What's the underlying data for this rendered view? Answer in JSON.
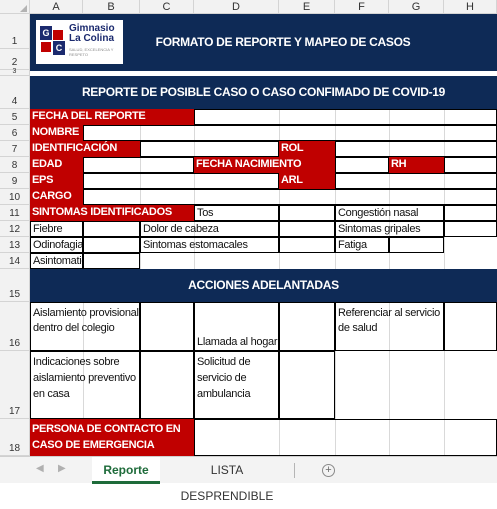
{
  "columns": [
    "A",
    "B",
    "C",
    "D",
    "E",
    "F",
    "G",
    "H"
  ],
  "rows": [
    "1",
    "2",
    "3",
    "4",
    "5",
    "6",
    "7",
    "8",
    "9",
    "10",
    "11",
    "12",
    "13",
    "14",
    "15",
    "16",
    "17",
    "18"
  ],
  "logo": {
    "initials_top": "G",
    "initials_bottom": "C",
    "name_line1": "Gimnasio",
    "name_line2": "La Colina",
    "tagline": "SALUD, EXCELENCIA Y RESPETO"
  },
  "title": "FORMATO DE REPORTE Y MAPEO DE CASOS",
  "subtitle": "REPORTE DE POSIBLE CASO O CASO CONFIMADO DE COVID-19",
  "labels": {
    "fecha_reporte": "FECHA DEL REPORTE",
    "nombre": "NOMBRE",
    "identificacion": "IDENTIFICACIÓN",
    "rol": "ROL",
    "edad": "EDAD",
    "fecha_nacimiento": "FECHA NACIMIENTO",
    "rh": "RH",
    "eps": "EPS",
    "arl": "ARL",
    "cargo": "CARGO",
    "sintomas": "SINTOMAS IDENTIFICADOS",
    "persona_contacto": "PERSONA DE CONTACTO EN CASO DE EMERGENCIA"
  },
  "symptoms": {
    "tos": "Tos",
    "congestion": "Congestión nasal",
    "fiebre": "Fiebre",
    "dolor_cabeza": "Dolor de cabeza",
    "gripales": "Sintomas gripales",
    "odinofagia": "Odinofagia",
    "estomacales": "Sintomas estomacales",
    "fatiga": "Fatiga",
    "asintomatico": "Asintomatico"
  },
  "acciones_title": "ACCIONES ADELANTADAS",
  "actions": {
    "aislamiento": "Aislamiento provisional dentro del colegio",
    "llamada": "Llamada al hogar",
    "referenciar": "Referenciar al servicio de salud",
    "indicaciones": "Indicaciones sobre aislamiento preventivo en casa",
    "ambulancia": "Solicitud de servicio de ambulancia"
  },
  "tabs": {
    "active": "Reporte",
    "second": "LISTA DESPRENDIBLE",
    "add": "+"
  },
  "colors": {
    "red": "#c00000",
    "navy": "#0e2a56",
    "tab_green": "#1e6b3a"
  }
}
